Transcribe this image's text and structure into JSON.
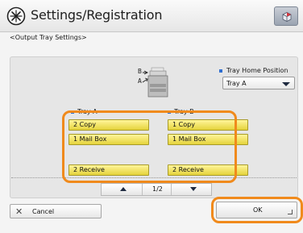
{
  "window": {
    "title": "Settings/Registration",
    "subtitle": "<Output Tray Settings>"
  },
  "icons": {
    "title_icon": "settings-registration-icon",
    "status_icon": "status-monitor-icon"
  },
  "printer": {
    "label_b": "B",
    "label_a": "A"
  },
  "tray_home": {
    "label": "Tray Home Position",
    "selected": "Tray A"
  },
  "trays": [
    {
      "header": "Tray A",
      "items": [
        "2 Copy",
        "1 Mail Box",
        "2 Receive"
      ]
    },
    {
      "header": "Tray B",
      "items": [
        "1 Copy",
        "1 Mail Box",
        "2 Receive"
      ]
    }
  ],
  "pager": {
    "page": "1/2"
  },
  "buttons": {
    "cancel": "Cancel",
    "ok": "OK"
  },
  "colors": {
    "accent_frame": "#f08a1c",
    "tray_button": "#fff59a",
    "bullet": "#2f6fd0"
  }
}
